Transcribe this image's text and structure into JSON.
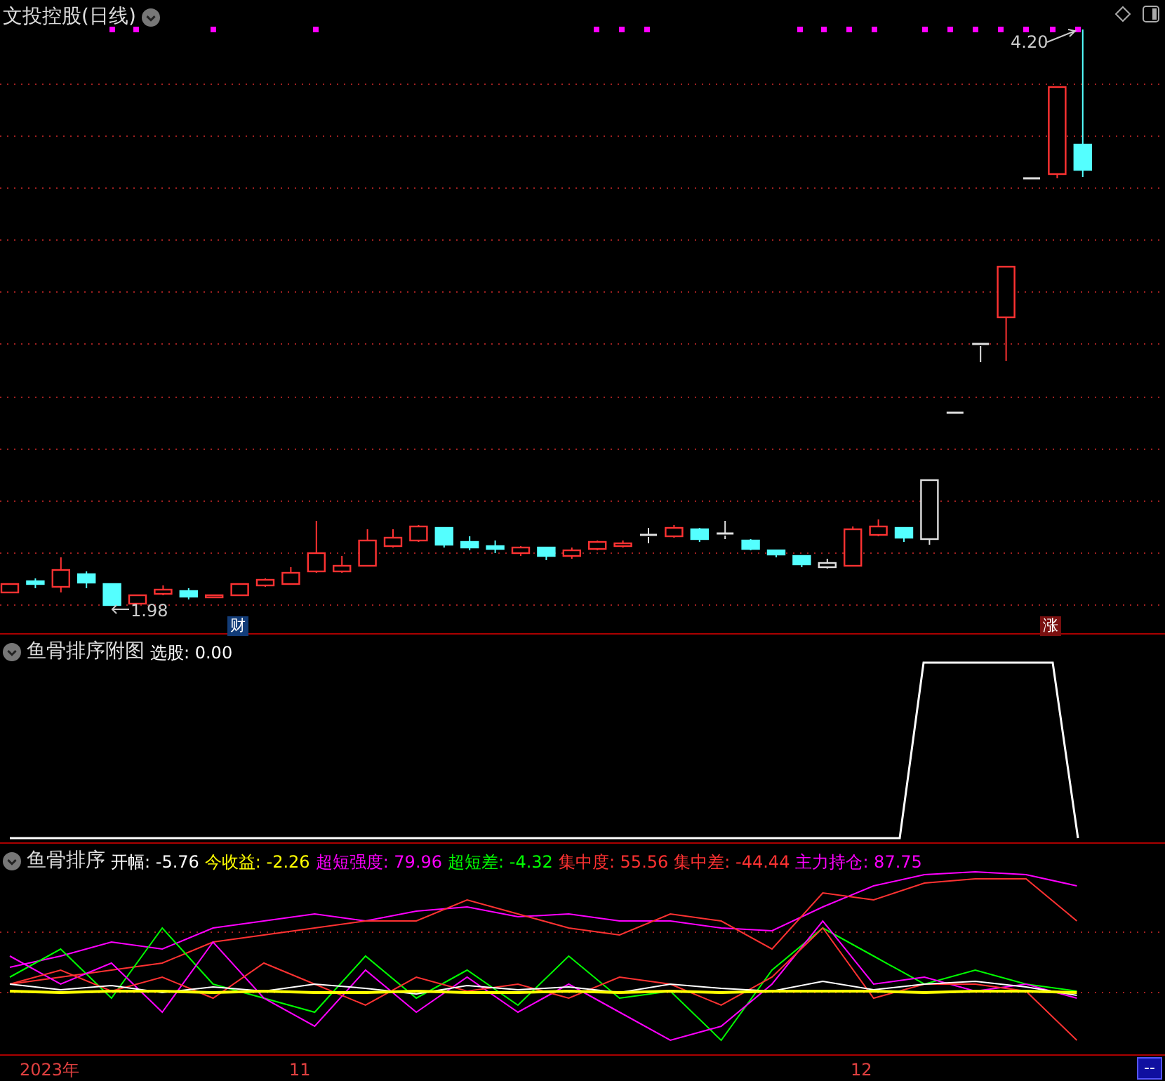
{
  "main_panel": {
    "title": "文投控股(日线)",
    "high_label": "4.20",
    "low_label": "1.98",
    "event_markers": [
      {
        "text": "财",
        "kind": "finance"
      },
      {
        "text": "涨",
        "kind": "limit_up"
      }
    ]
  },
  "sub_panel_1": {
    "title": "鱼骨排序附图",
    "readouts": [
      {
        "label": "选股:",
        "value": "0.00",
        "color": "#ffffff"
      }
    ]
  },
  "sub_panel_2": {
    "title": "鱼骨排序",
    "readouts": [
      {
        "label": "开幅:",
        "value": "-5.76",
        "color": "#ffffff"
      },
      {
        "label": "今收益:",
        "value": "-2.26",
        "color": "#ffff00"
      },
      {
        "label": "超短强度:",
        "value": "79.96",
        "color": "#ff00ff"
      },
      {
        "label": "超短差:",
        "value": "-4.32",
        "color": "#00ff00"
      },
      {
        "label": "集中度:",
        "value": "55.56",
        "color": "#ff3232"
      },
      {
        "label": "集中差:",
        "value": "-44.44",
        "color": "#ff3232"
      },
      {
        "label": "主力持仓:",
        "value": "87.75",
        "color": "#ff00ff"
      }
    ]
  },
  "x_axis": {
    "labels": [
      "2023年",
      "11",
      "12"
    ],
    "corner": "--"
  }
}
